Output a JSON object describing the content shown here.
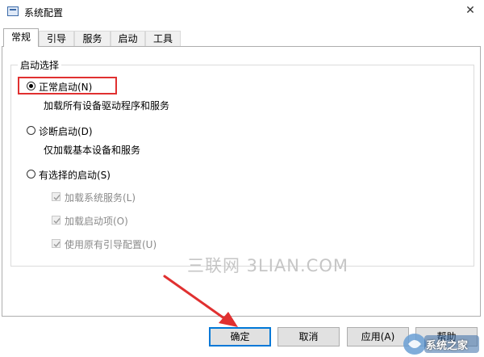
{
  "window": {
    "title": "系统配置",
    "close_glyph": "✕"
  },
  "tabs": [
    {
      "label": "常规",
      "active": true
    },
    {
      "label": "引导",
      "active": false
    },
    {
      "label": "服务",
      "active": false
    },
    {
      "label": "启动",
      "active": false
    },
    {
      "label": "工具",
      "active": false
    }
  ],
  "startup": {
    "group_title": "启动选择",
    "normal": {
      "label": "正常启动(N)",
      "desc": "加载所有设备驱动程序和服务",
      "checked": true
    },
    "diagnostic": {
      "label": "诊断启动(D)",
      "desc": "仅加载基本设备和服务",
      "checked": false
    },
    "selective": {
      "label": "有选择的启动(S)",
      "checked": false,
      "options": [
        {
          "label": "加载系统服务(L)",
          "checked": true,
          "disabled": true
        },
        {
          "label": "加载启动项(O)",
          "checked": true,
          "disabled": true
        },
        {
          "label": "使用原有引导配置(U)",
          "checked": true,
          "disabled": true
        }
      ]
    }
  },
  "watermark": "三联网 3LIAN.COM",
  "buttons": {
    "ok": "确定",
    "cancel": "取消",
    "apply": "应用(A)",
    "help": "帮助"
  },
  "logo": {
    "text": "系统之家"
  },
  "colors": {
    "highlight": "#e03030",
    "arrow": "#e03030",
    "focus": "#0078d7"
  }
}
